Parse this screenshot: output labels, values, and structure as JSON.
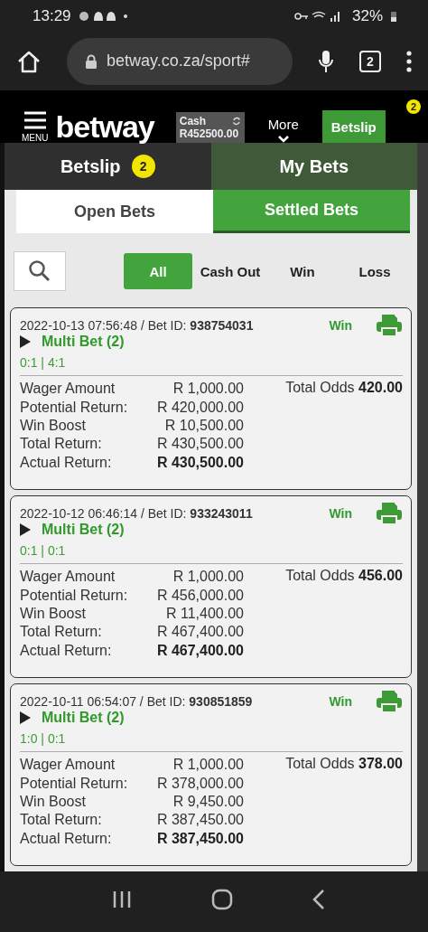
{
  "status_bar": {
    "time": "13:29",
    "battery": "32%"
  },
  "browser": {
    "url": "betway.co.za/sport#",
    "tab_count": "2"
  },
  "header": {
    "menu_label": "MENU",
    "logo": "betway",
    "cash_label": "Cash",
    "cash_amount": "R452500.00",
    "more_label": "More",
    "betslip_button": "Betslip",
    "betslip_badge": "2"
  },
  "tabs": [
    {
      "label": "Betslip",
      "badge": "2",
      "selected": false
    },
    {
      "label": "My Bets",
      "selected": true
    }
  ],
  "sub_tabs": [
    {
      "label": "Open Bets",
      "selected": false
    },
    {
      "label": "Settled Bets",
      "selected": true
    }
  ],
  "filters": [
    {
      "label": "All",
      "selected": true
    },
    {
      "label": "Cash Out",
      "selected": false
    },
    {
      "label": "Win",
      "selected": false
    },
    {
      "label": "Loss",
      "selected": false
    }
  ],
  "bets": [
    {
      "datetime": "2022-10-13 07:56:48 / Bet ID: ",
      "bet_id": "938754031",
      "result": "Win",
      "title": "Multi Bet (2)",
      "scores": "0:1 | 4:1",
      "total_odds_label": "Total Odds ",
      "total_odds": "420.00",
      "lines": [
        {
          "label": "Wager Amount",
          "value": "R 1,000.00"
        },
        {
          "label": "Potential Return:",
          "value": "R 420,000.00"
        },
        {
          "label": "Win Boost",
          "value": "R 10,500.00"
        },
        {
          "label": "Total Return:",
          "value": "R 430,500.00"
        },
        {
          "label": "Actual Return:",
          "value": "R 430,500.00"
        }
      ]
    },
    {
      "datetime": "2022-10-12 06:46:14 / Bet ID: ",
      "bet_id": "933243011",
      "result": "Win",
      "title": "Multi Bet (2)",
      "scores": "0:1 | 0:1",
      "total_odds_label": "Total Odds ",
      "total_odds": "456.00",
      "lines": [
        {
          "label": "Wager Amount",
          "value": "R 1,000.00"
        },
        {
          "label": "Potential Return:",
          "value": "R 456,000.00"
        },
        {
          "label": "Win Boost",
          "value": "R 11,400.00"
        },
        {
          "label": "Total Return:",
          "value": "R 467,400.00"
        },
        {
          "label": "Actual Return:",
          "value": "R 467,400.00"
        }
      ]
    },
    {
      "datetime": "2022-10-11 06:54:07 / Bet ID: ",
      "bet_id": "930851859",
      "result": "Win",
      "title": "Multi Bet (2)",
      "scores": "1:0 | 0:1",
      "total_odds_label": "Total Odds ",
      "total_odds": "378.00",
      "lines": [
        {
          "label": "Wager Amount",
          "value": "R 1,000.00"
        },
        {
          "label": "Potential Return:",
          "value": "R 378,000.00"
        },
        {
          "label": "Win Boost",
          "value": "R 9,450.00"
        },
        {
          "label": "Total Return:",
          "value": "R 387,450.00"
        },
        {
          "label": "Actual Return:",
          "value": "R 387,450.00"
        }
      ]
    }
  ]
}
